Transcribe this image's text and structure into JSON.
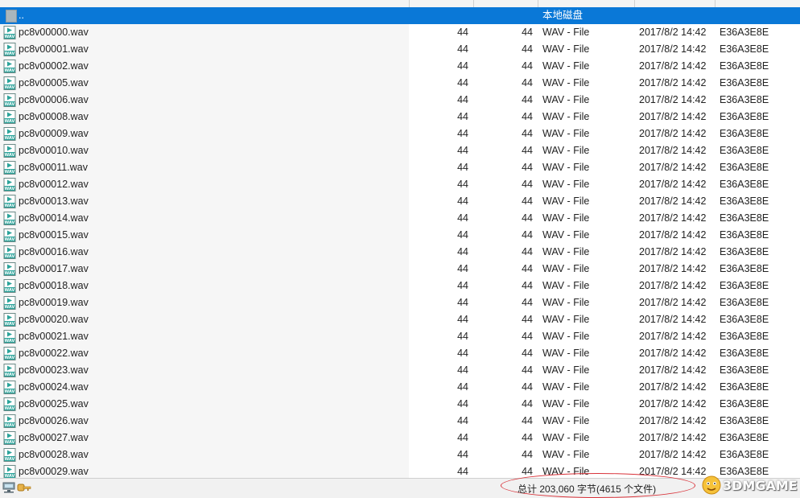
{
  "up_row": {
    "label": "..",
    "type": "本地磁盘"
  },
  "files": [
    {
      "name": "pc8v00000.wav",
      "size": "44",
      "compressed": "44",
      "type": "WAV - File",
      "date": "2017/8/2 14:42",
      "crc": "E36A3E8E"
    },
    {
      "name": "pc8v00001.wav",
      "size": "44",
      "compressed": "44",
      "type": "WAV - File",
      "date": "2017/8/2 14:42",
      "crc": "E36A3E8E"
    },
    {
      "name": "pc8v00002.wav",
      "size": "44",
      "compressed": "44",
      "type": "WAV - File",
      "date": "2017/8/2 14:42",
      "crc": "E36A3E8E"
    },
    {
      "name": "pc8v00005.wav",
      "size": "44",
      "compressed": "44",
      "type": "WAV - File",
      "date": "2017/8/2 14:42",
      "crc": "E36A3E8E"
    },
    {
      "name": "pc8v00006.wav",
      "size": "44",
      "compressed": "44",
      "type": "WAV - File",
      "date": "2017/8/2 14:42",
      "crc": "E36A3E8E"
    },
    {
      "name": "pc8v00008.wav",
      "size": "44",
      "compressed": "44",
      "type": "WAV - File",
      "date": "2017/8/2 14:42",
      "crc": "E36A3E8E"
    },
    {
      "name": "pc8v00009.wav",
      "size": "44",
      "compressed": "44",
      "type": "WAV - File",
      "date": "2017/8/2 14:42",
      "crc": "E36A3E8E"
    },
    {
      "name": "pc8v00010.wav",
      "size": "44",
      "compressed": "44",
      "type": "WAV - File",
      "date": "2017/8/2 14:42",
      "crc": "E36A3E8E"
    },
    {
      "name": "pc8v00011.wav",
      "size": "44",
      "compressed": "44",
      "type": "WAV - File",
      "date": "2017/8/2 14:42",
      "crc": "E36A3E8E"
    },
    {
      "name": "pc8v00012.wav",
      "size": "44",
      "compressed": "44",
      "type": "WAV - File",
      "date": "2017/8/2 14:42",
      "crc": "E36A3E8E"
    },
    {
      "name": "pc8v00013.wav",
      "size": "44",
      "compressed": "44",
      "type": "WAV - File",
      "date": "2017/8/2 14:42",
      "crc": "E36A3E8E"
    },
    {
      "name": "pc8v00014.wav",
      "size": "44",
      "compressed": "44",
      "type": "WAV - File",
      "date": "2017/8/2 14:42",
      "crc": "E36A3E8E"
    },
    {
      "name": "pc8v00015.wav",
      "size": "44",
      "compressed": "44",
      "type": "WAV - File",
      "date": "2017/8/2 14:42",
      "crc": "E36A3E8E"
    },
    {
      "name": "pc8v00016.wav",
      "size": "44",
      "compressed": "44",
      "type": "WAV - File",
      "date": "2017/8/2 14:42",
      "crc": "E36A3E8E"
    },
    {
      "name": "pc8v00017.wav",
      "size": "44",
      "compressed": "44",
      "type": "WAV - File",
      "date": "2017/8/2 14:42",
      "crc": "E36A3E8E"
    },
    {
      "name": "pc8v00018.wav",
      "size": "44",
      "compressed": "44",
      "type": "WAV - File",
      "date": "2017/8/2 14:42",
      "crc": "E36A3E8E"
    },
    {
      "name": "pc8v00019.wav",
      "size": "44",
      "compressed": "44",
      "type": "WAV - File",
      "date": "2017/8/2 14:42",
      "crc": "E36A3E8E"
    },
    {
      "name": "pc8v00020.wav",
      "size": "44",
      "compressed": "44",
      "type": "WAV - File",
      "date": "2017/8/2 14:42",
      "crc": "E36A3E8E"
    },
    {
      "name": "pc8v00021.wav",
      "size": "44",
      "compressed": "44",
      "type": "WAV - File",
      "date": "2017/8/2 14:42",
      "crc": "E36A3E8E"
    },
    {
      "name": "pc8v00022.wav",
      "size": "44",
      "compressed": "44",
      "type": "WAV - File",
      "date": "2017/8/2 14:42",
      "crc": "E36A3E8E"
    },
    {
      "name": "pc8v00023.wav",
      "size": "44",
      "compressed": "44",
      "type": "WAV - File",
      "date": "2017/8/2 14:42",
      "crc": "E36A3E8E"
    },
    {
      "name": "pc8v00024.wav",
      "size": "44",
      "compressed": "44",
      "type": "WAV - File",
      "date": "2017/8/2 14:42",
      "crc": "E36A3E8E"
    },
    {
      "name": "pc8v00025.wav",
      "size": "44",
      "compressed": "44",
      "type": "WAV - File",
      "date": "2017/8/2 14:42",
      "crc": "E36A3E8E"
    },
    {
      "name": "pc8v00026.wav",
      "size": "44",
      "compressed": "44",
      "type": "WAV - File",
      "date": "2017/8/2 14:42",
      "crc": "E36A3E8E"
    },
    {
      "name": "pc8v00027.wav",
      "size": "44",
      "compressed": "44",
      "type": "WAV - File",
      "date": "2017/8/2 14:42",
      "crc": "E36A3E8E"
    },
    {
      "name": "pc8v00028.wav",
      "size": "44",
      "compressed": "44",
      "type": "WAV - File",
      "date": "2017/8/2 14:42",
      "crc": "E36A3E8E"
    },
    {
      "name": "pc8v00029.wav",
      "size": "44",
      "compressed": "44",
      "type": "WAV - File",
      "date": "2017/8/2 14:42",
      "crc": "E36A3E8E"
    }
  ],
  "file_icon": "wav-file-icon",
  "status": {
    "summary": "总计 203,060 字节(4615 个文件)",
    "icons": [
      "network-drive-icon",
      "key-icon"
    ]
  },
  "watermark": {
    "text": "3DMGAME"
  },
  "colors": {
    "selection": "#0a78d7",
    "wav_icon": "#2aa39a",
    "annotation_ellipse": "#d9333a"
  }
}
